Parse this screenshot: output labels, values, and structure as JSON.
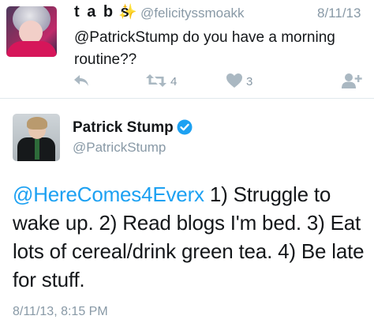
{
  "reply_tweet": {
    "display_name": "t a b s",
    "sparkle_glyph": "✨",
    "handle": "@felicityssmoakk",
    "date": "8/11/13",
    "text": "@PatrickStump do you have a morning routine??",
    "retweet_count": "4",
    "like_count": "3",
    "icons": [
      "reply-icon",
      "retweet-icon",
      "heart-icon",
      "follow-icon"
    ]
  },
  "main_tweet": {
    "display_name": "Patrick Stump",
    "handle": "@PatrickStump",
    "mention": "@HereComes4Everx",
    "text": " 1) Struggle to wake up. 2) Read blogs I'm bed. 3) Eat lots of cereal/drink green tea. 4) Be late for stuff.",
    "timestamp": "8/11/13, 8:15 PM",
    "verified": true
  },
  "colors": {
    "accent": "#1da1f2",
    "muted": "#8899a6",
    "text": "#14171a",
    "divider": "#e1e8ed"
  }
}
